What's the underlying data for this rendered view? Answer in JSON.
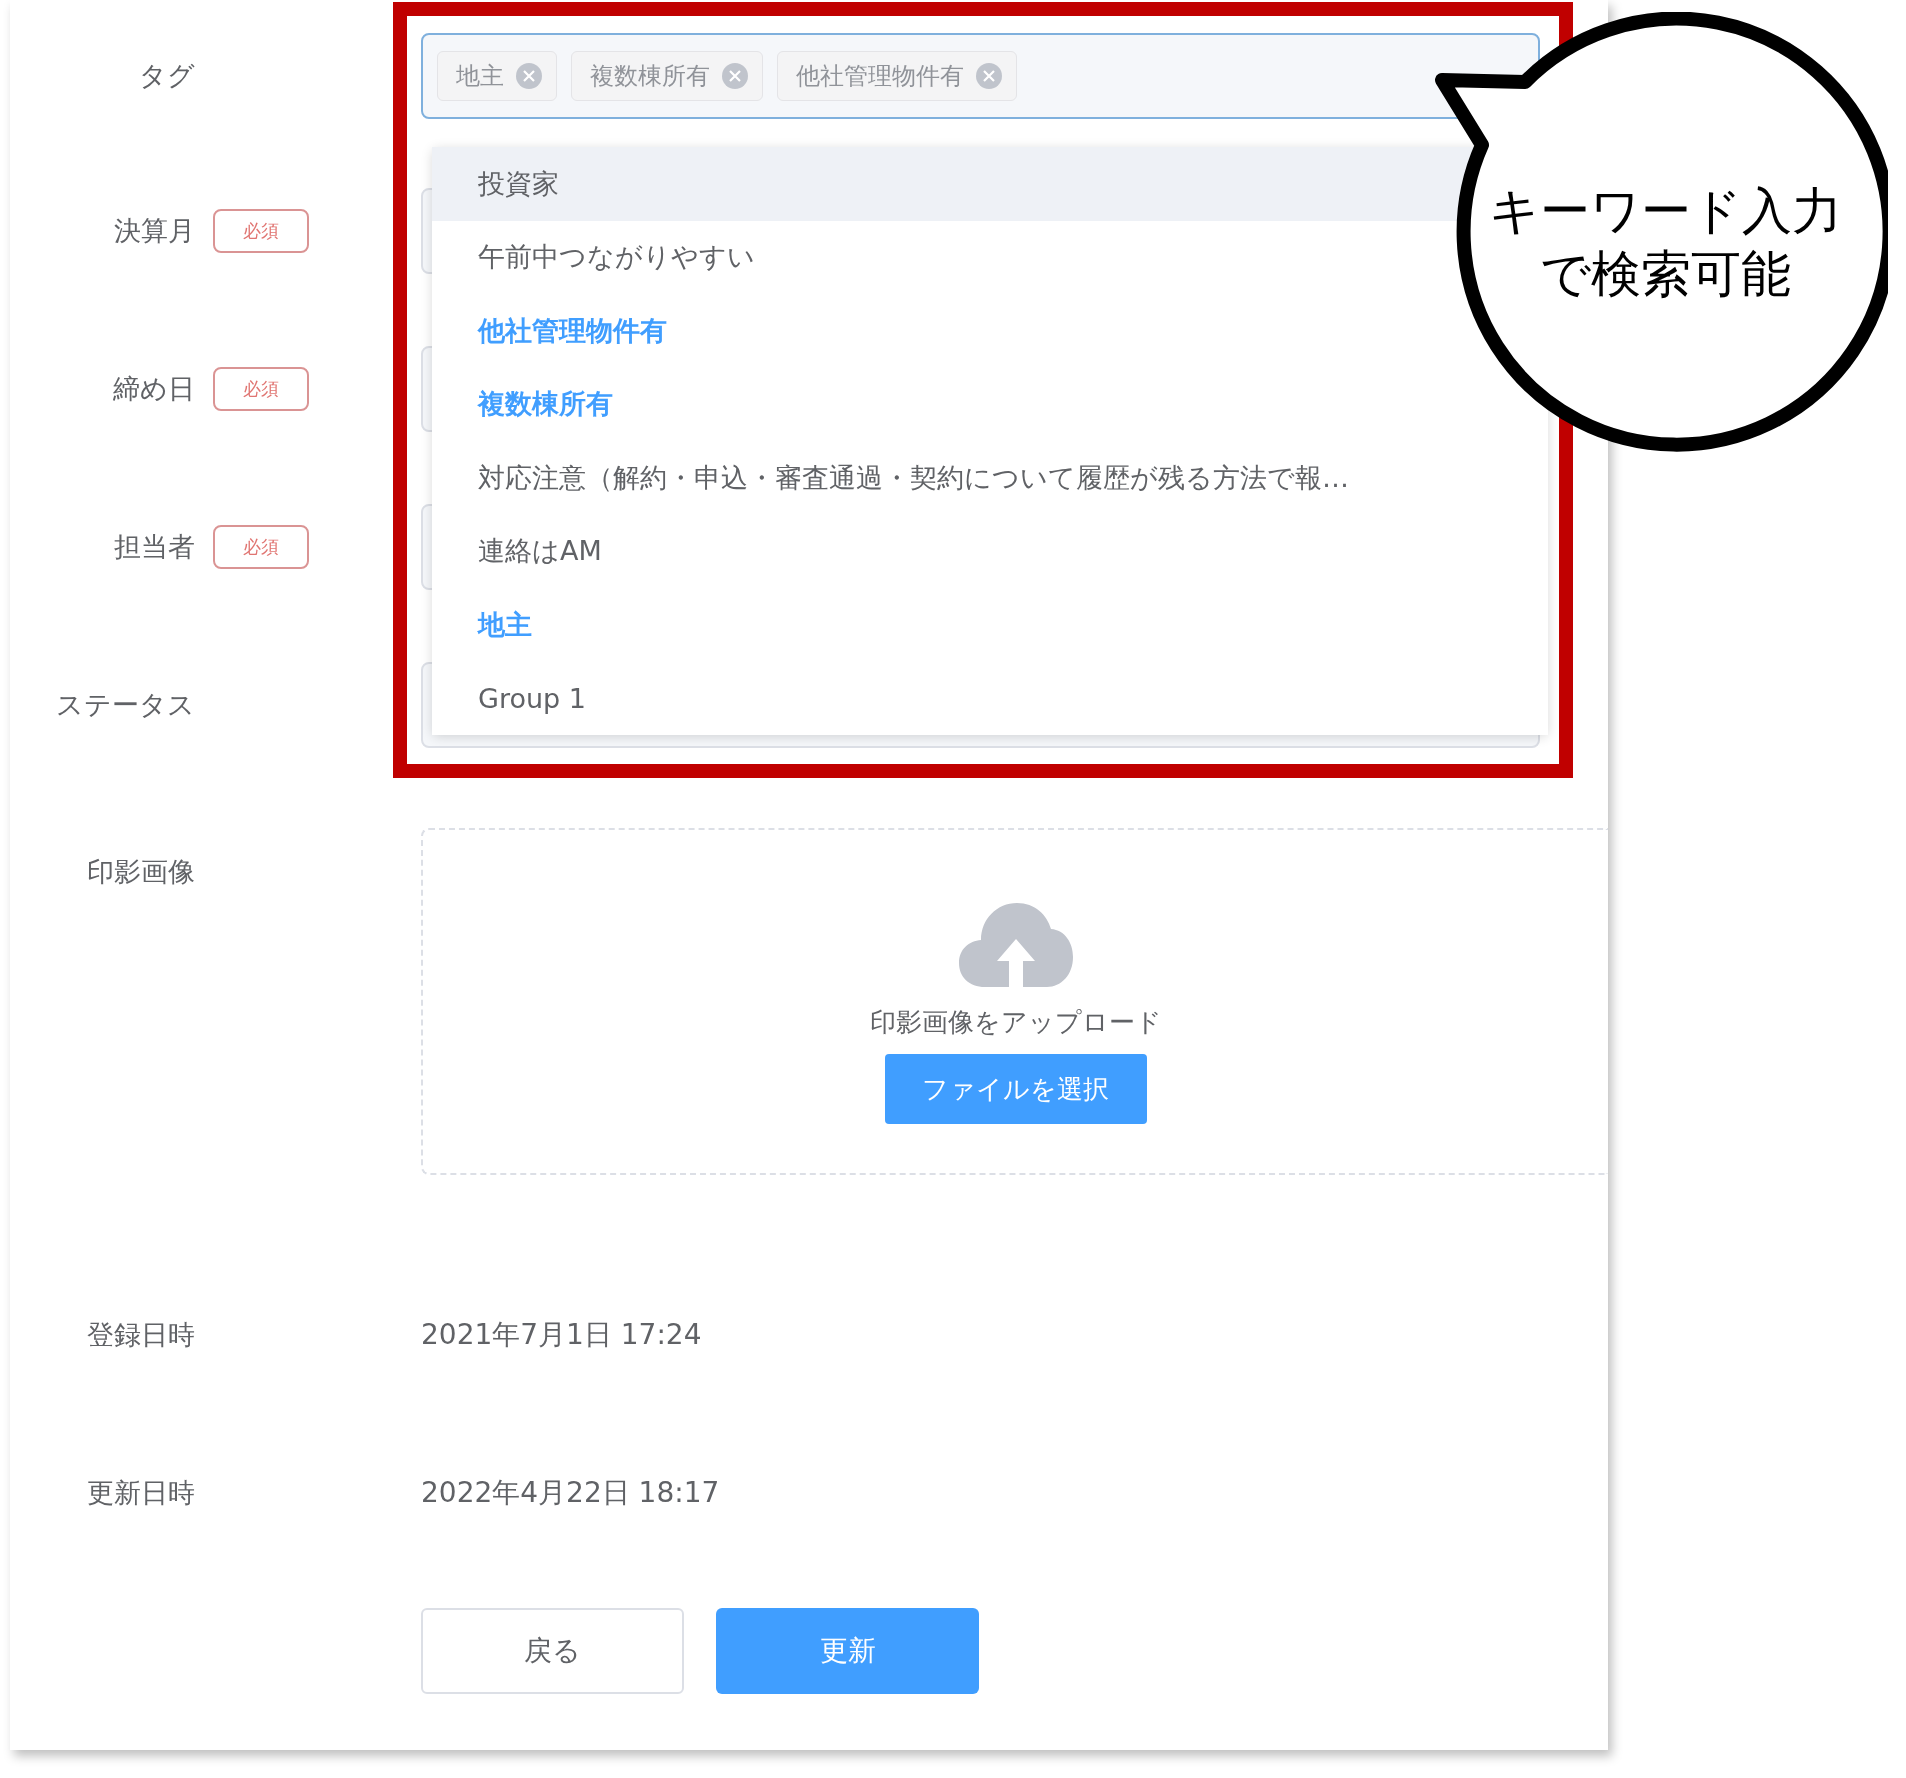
{
  "form": {
    "fields": [
      {
        "label": "タグ",
        "kind": "tag-select",
        "tags": [
          "地主",
          "複数棟所有",
          "他社管理物件有"
        ]
      },
      {
        "label": "決算月",
        "kind": "input",
        "badge": "必須"
      },
      {
        "label": "締め日",
        "kind": "input",
        "badge": "必須"
      },
      {
        "label": "担当者",
        "kind": "input",
        "badge": "必須"
      },
      {
        "label": "ステータス",
        "kind": "input"
      },
      {
        "label": "印影画像",
        "kind": "upload",
        "prompt": "印影画像をアップロード",
        "button": "ファイルを選択"
      },
      {
        "label": "登録日時",
        "kind": "text",
        "value": "2021年7月1日 17:24"
      },
      {
        "label": "更新日時",
        "kind": "text",
        "value": "2022年4月22日 18:17"
      }
    ],
    "buttons": [
      {
        "label": "戻る",
        "kind": "secondary"
      },
      {
        "label": "更新",
        "kind": "primary"
      }
    ]
  },
  "dropdown": {
    "options": [
      {
        "label": "投資家",
        "selected": false,
        "hovered": true
      },
      {
        "label": "午前中つながりやすい",
        "selected": false,
        "hovered": false
      },
      {
        "label": "他社管理物件有",
        "selected": true,
        "hovered": false
      },
      {
        "label": "複数棟所有",
        "selected": true,
        "hovered": false
      },
      {
        "label": "対応注意（解約・申込・審査通過・契約について履歴が残る方法で報…",
        "selected": false,
        "hovered": false
      },
      {
        "label": "連絡はAM",
        "selected": false,
        "hovered": false
      },
      {
        "label": "地主",
        "selected": true,
        "hovered": false
      },
      {
        "label": "Group 1",
        "selected": false,
        "hovered": false
      }
    ]
  },
  "callout": {
    "lines": [
      "キーワード入力",
      "で検索可能"
    ]
  }
}
